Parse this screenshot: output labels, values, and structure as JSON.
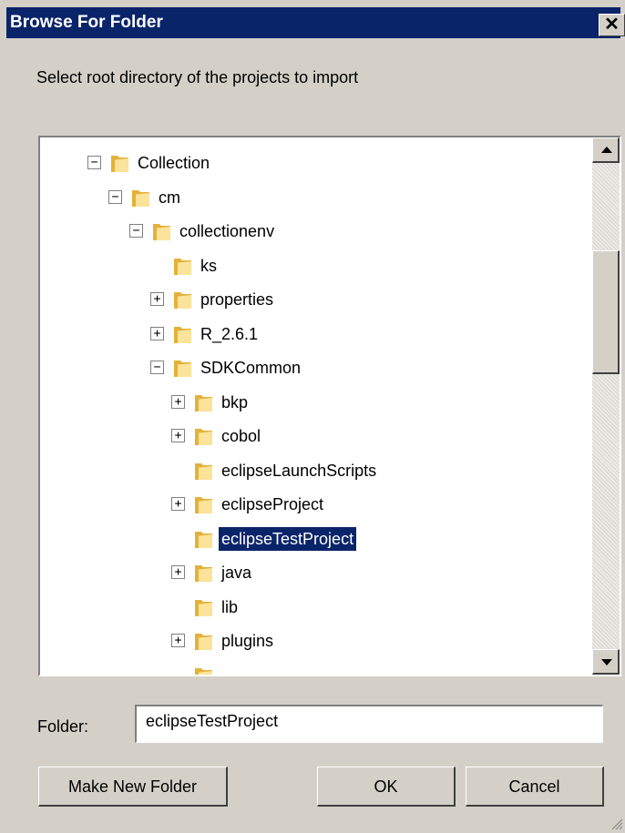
{
  "dialog": {
    "title": "Browse For Folder",
    "close_label": "✕",
    "instruction": "Select root directory of the projects to import"
  },
  "tree": {
    "nodes": [
      {
        "label": "Collection",
        "level": 0,
        "expander": "minus",
        "selected": false
      },
      {
        "label": "cm",
        "level": 1,
        "expander": "minus",
        "selected": false
      },
      {
        "label": "collectionenv",
        "level": 2,
        "expander": "minus",
        "selected": false
      },
      {
        "label": "ks",
        "level": 3,
        "expander": "none",
        "selected": false
      },
      {
        "label": "properties",
        "level": 3,
        "expander": "plus",
        "selected": false
      },
      {
        "label": "R_2.6.1",
        "level": 3,
        "expander": "plus",
        "selected": false
      },
      {
        "label": "SDKCommon",
        "level": 3,
        "expander": "minus",
        "selected": false
      },
      {
        "label": "bkp",
        "level": 4,
        "expander": "plus",
        "selected": false
      },
      {
        "label": "cobol",
        "level": 4,
        "expander": "plus",
        "selected": false
      },
      {
        "label": "eclipseLaunchScripts",
        "level": 4,
        "expander": "none",
        "selected": false
      },
      {
        "label": "eclipseProject",
        "level": 4,
        "expander": "plus",
        "selected": false
      },
      {
        "label": "eclipseTestProject",
        "level": 4,
        "expander": "none",
        "selected": true
      },
      {
        "label": "java",
        "level": 4,
        "expander": "plus",
        "selected": false
      },
      {
        "label": "lib",
        "level": 4,
        "expander": "none",
        "selected": false
      },
      {
        "label": "plugins",
        "level": 4,
        "expander": "plus",
        "selected": false
      },
      {
        "label": "",
        "level": 4,
        "expander": "none",
        "selected": false
      }
    ]
  },
  "folder_field": {
    "label": "Folder:",
    "value": "eclipseTestProject"
  },
  "buttons": {
    "make_new_folder": "Make New Folder",
    "ok": "OK",
    "cancel": "Cancel"
  },
  "colors": {
    "title_bar": "#0a246a",
    "selection": "#0a246a",
    "face": "#d4d0c8",
    "folder_light": "#fbe39a",
    "folder_dark": "#e4b23a"
  }
}
